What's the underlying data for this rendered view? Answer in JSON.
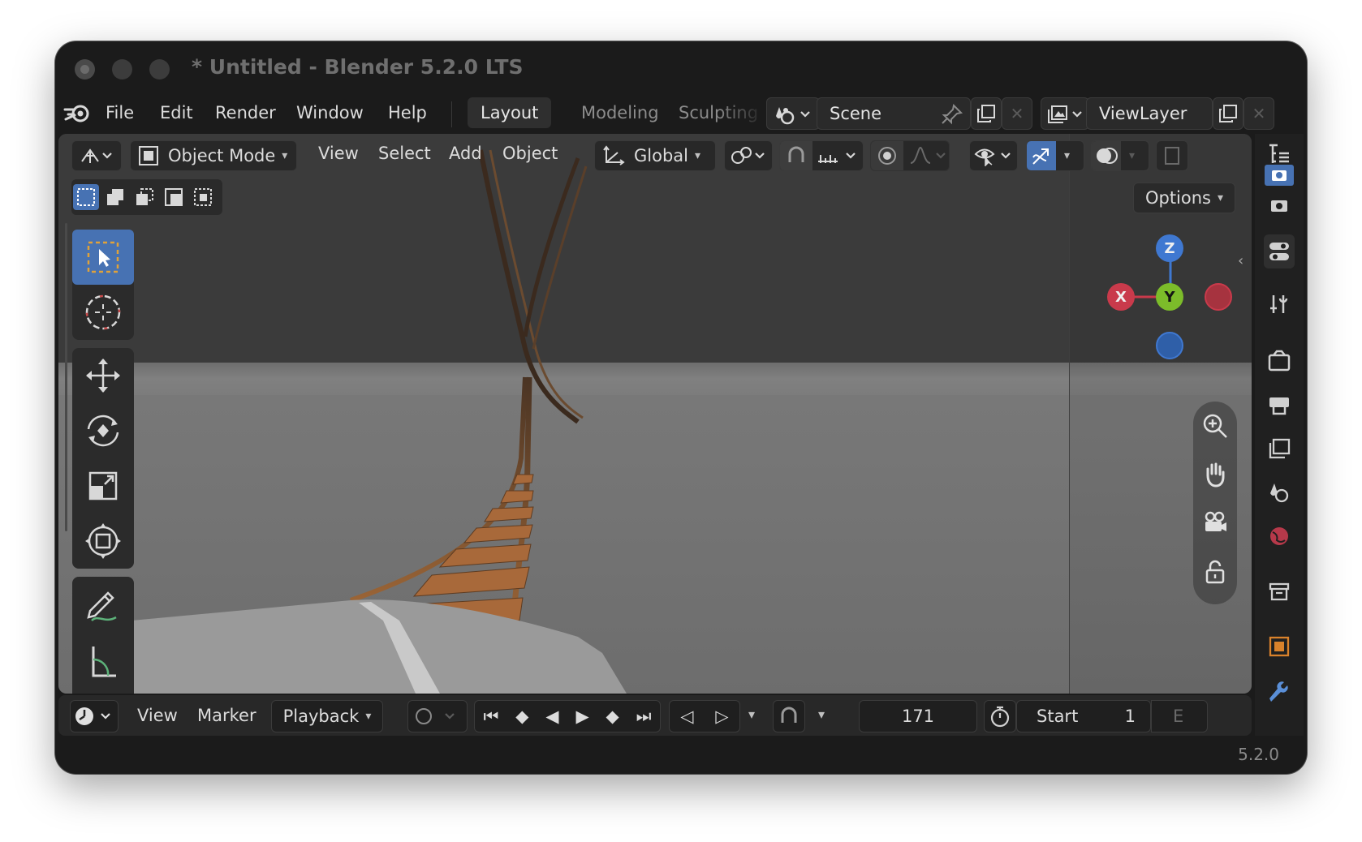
{
  "window": {
    "title": "* Untitled - Blender 5.2.0 LTS"
  },
  "menu": [
    "File",
    "Edit",
    "Render",
    "Window",
    "Help"
  ],
  "workspaces": [
    "Layout",
    "Modeling",
    "Sculpting"
  ],
  "scene": {
    "name": "Scene"
  },
  "view_layer": {
    "name": "ViewLayer"
  },
  "viewport_header": {
    "mode": "Object Mode",
    "menus": [
      "View",
      "Select",
      "Add",
      "Object"
    ],
    "orientation": "Global"
  },
  "options_label": "Options",
  "gizmo": {
    "z": "Z",
    "x": "X",
    "y": "Y"
  },
  "timeline": {
    "menus": [
      "View",
      "Marker"
    ],
    "playback": "Playback",
    "current_frame": "171",
    "start_label": "Start",
    "start_value": "1",
    "end_label_partial": "E"
  },
  "version": "5.2.0",
  "colors": {
    "accent": "#4772b3",
    "x_axis": "#c93a4b",
    "y_axis": "#7cbc2a",
    "z_axis": "#3f78d1",
    "track": "#a86a3a"
  }
}
